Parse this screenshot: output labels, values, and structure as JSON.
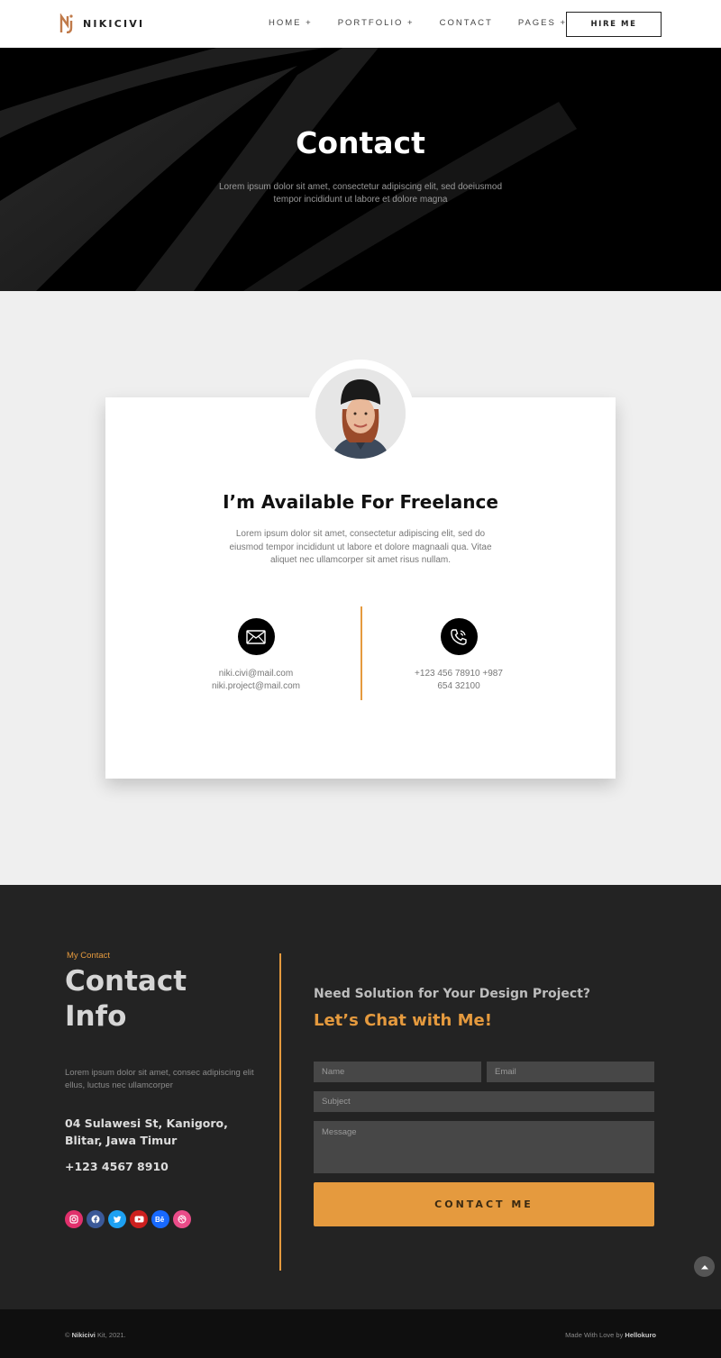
{
  "header": {
    "brand": "NIKICIVI",
    "nav": [
      {
        "label": "HOME +"
      },
      {
        "label": "PORTFOLIO +"
      },
      {
        "label": "CONTACT"
      },
      {
        "label": "PAGES +"
      }
    ],
    "hire_label": "HIRE ME"
  },
  "hero": {
    "title": "Contact",
    "subtitle": "Lorem ipsum dolor sit amet, consectetur adipiscing elit, sed doeiusmod tempor incididunt ut labore et dolore magna"
  },
  "card": {
    "title": "I’m Available For Freelance",
    "description": "Lorem ipsum dolor sit amet, consectetur adipiscing elit, sed do eiusmod tempor incididunt ut labore et dolore magnaali qua. Vitae aliquet nec ullamcorper sit amet risus nullam.",
    "email_1": "niki.civi@mail.com",
    "email_2": "niki.project@mail.com",
    "phone_1": "+123 456 78910 +987",
    "phone_2": "654 32100"
  },
  "contact_info": {
    "eyebrow": "My Contact",
    "title_line1": "Contact",
    "title_line2": "Info",
    "description": "Lorem ipsum dolor sit amet, consec adipiscing elit ellus, luctus nec ullamcorper",
    "address": "04 Sulawesi St, Kanigoro, Blitar, Jawa Timur",
    "phone": "+123 4567 8910",
    "socials": [
      {
        "icon": "instagram-icon",
        "color": "#e1306c"
      },
      {
        "icon": "facebook-icon",
        "color": "#3b5998"
      },
      {
        "icon": "twitter-icon",
        "color": "#1da1f2"
      },
      {
        "icon": "youtube-icon",
        "color": "#cd201f"
      },
      {
        "icon": "behance-icon",
        "color": "#1769ff"
      },
      {
        "icon": "dribbble-icon",
        "color": "#ea4c89"
      }
    ]
  },
  "form": {
    "heading": "Need Solution for Your Design Project?",
    "subheading": "Let’s Chat with Me!",
    "name_placeholder": "Name",
    "email_placeholder": "Email",
    "subject_placeholder": "Subject",
    "message_placeholder": "Message",
    "submit_label": "CONTACT ME"
  },
  "footer": {
    "brand": "Nikicivi",
    "copyright_rest": " Kit, 2021.",
    "copyright_symbol": "©",
    "made_prefix": "Made With Love by ",
    "made_by": "Hellokuro"
  },
  "colors": {
    "accent": "#e59a3e",
    "dark": "#232323"
  }
}
